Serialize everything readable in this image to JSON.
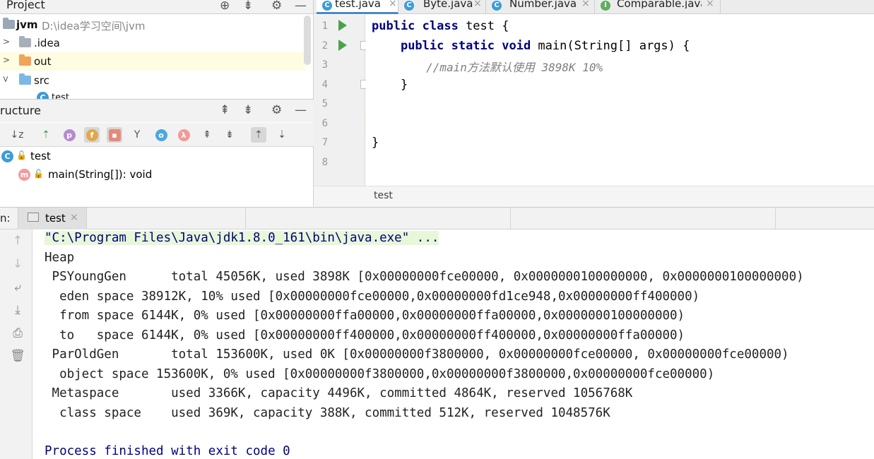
{
  "project": {
    "title": "Project",
    "root_name": "jvm",
    "root_path": "D:\\idea学习空间\\jvm",
    "items": [
      {
        "label": ".idea",
        "icon": "folder-icon"
      },
      {
        "label": "out",
        "icon": "folder-orange-icon"
      },
      {
        "label": "src",
        "icon": "source-folder-icon"
      },
      {
        "label": "test",
        "icon": "class-icon"
      }
    ]
  },
  "structure": {
    "title": "ructure",
    "class_name": "test",
    "method": "main(String[]): void"
  },
  "editor": {
    "tabs": [
      {
        "label": "test.java",
        "icon_letter": "C",
        "active": true
      },
      {
        "label": "Byte.java",
        "icon_letter": "C",
        "active": false
      },
      {
        "label": "Number.java",
        "icon_letter": "C",
        "active": false
      },
      {
        "label": "Comparable.java",
        "icon_letter": "I",
        "active": false
      }
    ],
    "line_numbers": [
      "1",
      "2",
      "3",
      "4",
      "5",
      "6",
      "7",
      "8"
    ],
    "code": {
      "l1_kw": "public class",
      "l1_rest": " test {",
      "l2_kw": "public static void",
      "l2_rest": " main(String[] args) {",
      "l3_comment": "//main方法默认使用 3898K 10%",
      "l4": "}",
      "l7": "}"
    },
    "breadcrumb": "test"
  },
  "run": {
    "label": "n:",
    "tab_label": "test",
    "console_lines": [
      "\"C:\\Program Files\\Java\\jdk1.8.0_161\\bin\\java.exe\" ...",
      "Heap",
      " PSYoungGen      total 45056K, used 3898K [0x00000000fce00000, 0x0000000100000000, 0x0000000100000000)",
      "  eden space 38912K, 10% used [0x00000000fce00000,0x00000000fd1ce948,0x00000000ff400000)",
      "  from space 6144K, 0% used [0x00000000ffa00000,0x00000000ffa00000,0x0000000100000000)",
      "  to   space 6144K, 0% used [0x00000000ff400000,0x00000000ff400000,0x00000000ffa00000)",
      " ParOldGen       total 153600K, used 0K [0x00000000f3800000, 0x00000000fce00000, 0x00000000fce00000)",
      "  object space 153600K, 0% used [0x00000000f3800000,0x00000000f3800000,0x00000000fce00000)",
      " Metaspace       used 3366K, capacity 4496K, committed 4864K, reserved 1056768K",
      "  class space    used 369K, capacity 388K, committed 512K, reserved 1048576K",
      "",
      "Process finished with exit code 0"
    ]
  },
  "colors": {
    "keyword": "#000080",
    "comment": "#808080",
    "caret_line": "#fefce1",
    "run_green": "#49a34a"
  }
}
